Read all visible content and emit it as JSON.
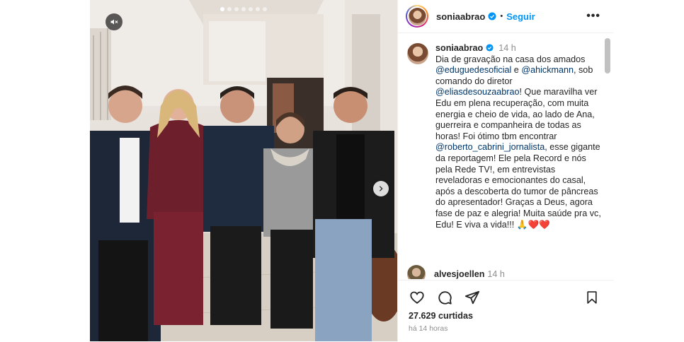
{
  "post": {
    "slide_count": 7,
    "active_slide": 1,
    "icons": {
      "mute": "muted-speaker-icon",
      "next": "chevron-right-icon"
    }
  },
  "header": {
    "username": "soniaabrao",
    "verified": true,
    "separator": "•",
    "follow_label": "Seguir",
    "more_label": "•••"
  },
  "caption": {
    "username": "soniaabrao",
    "time": "14 h",
    "segments": [
      {
        "text": "Dia de gravação na casa dos amados ",
        "mention": false
      },
      {
        "text": "@eduguedesoficial",
        "mention": true
      },
      {
        "text": " e ",
        "mention": false
      },
      {
        "text": "@ahickmann",
        "mention": true
      },
      {
        "text": ", sob comando do diretor ",
        "mention": false
      },
      {
        "text": "@eliasdesouzaabrao",
        "mention": true
      },
      {
        "text": "! Que maravilha ver Edu em plena recuperação, com muita energia e cheio de vida, ao lado de Ana, guerreira e companheira de todas as horas! Foi ótimo tbm encontrar ",
        "mention": false
      },
      {
        "text": "@roberto_cabrini_jornalista",
        "mention": true
      },
      {
        "text": ", esse gigante da reportagem! Ele pela Record e nós pela Rede TV!, em entrevistas reveladoras e emocionantes do casal, após a descoberta do tumor de pâncreas do apresentador! Graças a Deus, agora fase de paz e alegria! Muita saúde pra vc, Edu! E viva a vida!!! 🙏❤️❤️",
        "mention": false
      }
    ]
  },
  "reply": {
    "username": "alvesjoellen",
    "time": "14 h"
  },
  "actions": {
    "likes": "27.629 curtidas",
    "posted": "há 14 horas",
    "icons": [
      "heart-icon",
      "comment-icon",
      "share-icon",
      "bookmark-icon"
    ]
  },
  "colors": {
    "accent": "#0095f6",
    "mention": "#00376b",
    "muted_text": "#8e8e8e",
    "text": "#262626"
  }
}
